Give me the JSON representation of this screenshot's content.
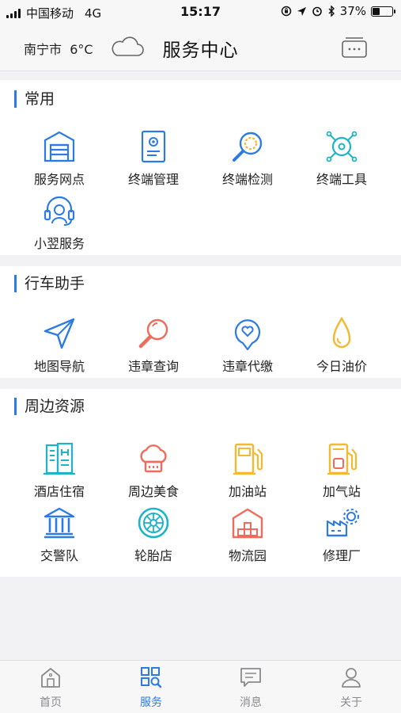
{
  "status_bar": {
    "carrier": "中国移动",
    "network": "4G",
    "time": "15:17",
    "battery": "37%",
    "battery_level": 0.37
  },
  "header": {
    "city": "南宁市",
    "temperature": "6°C",
    "weather_icon": "cloud-icon",
    "title": "服务中心",
    "right_icon": "cards-icon"
  },
  "sections": [
    {
      "title": "常用",
      "items": [
        {
          "label": "服务网点",
          "icon": "service-outlet-icon"
        },
        {
          "label": "终端管理",
          "icon": "terminal-manage-icon"
        },
        {
          "label": "终端检测",
          "icon": "terminal-detect-icon"
        },
        {
          "label": "终端工具",
          "icon": "terminal-tools-icon"
        },
        {
          "label": "小翌服务",
          "icon": "headset-icon"
        }
      ]
    },
    {
      "title": "行车助手",
      "items": [
        {
          "label": "地图导航",
          "icon": "navigation-icon"
        },
        {
          "label": "违章查询",
          "icon": "search-icon"
        },
        {
          "label": "违章代缴",
          "icon": "pay-heart-icon"
        },
        {
          "label": "今日油价",
          "icon": "oil-drop-icon"
        }
      ]
    },
    {
      "title": "周边资源",
      "items": [
        {
          "label": "酒店住宿",
          "icon": "hotel-icon"
        },
        {
          "label": "周边美食",
          "icon": "chef-hat-icon"
        },
        {
          "label": "加油站",
          "icon": "gas-station-icon"
        },
        {
          "label": "加气站",
          "icon": "gas-refill-icon"
        },
        {
          "label": "交警队",
          "icon": "police-building-icon"
        },
        {
          "label": "轮胎店",
          "icon": "tire-icon"
        },
        {
          "label": "物流园",
          "icon": "logistics-icon"
        },
        {
          "label": "修理厂",
          "icon": "factory-icon"
        }
      ]
    }
  ],
  "tabbar": {
    "tabs": [
      {
        "label": "首页",
        "icon": "home-icon",
        "active": false
      },
      {
        "label": "服务",
        "icon": "service-grid-icon",
        "active": true
      },
      {
        "label": "消息",
        "icon": "message-icon",
        "active": false
      },
      {
        "label": "关于",
        "icon": "user-icon",
        "active": false
      }
    ]
  },
  "colors": {
    "accent": "#2c7be5",
    "teal": "#1fb3c8",
    "red": "#f06b5c",
    "yellow": "#f5b82e",
    "inactive": "#8a8a8e"
  }
}
